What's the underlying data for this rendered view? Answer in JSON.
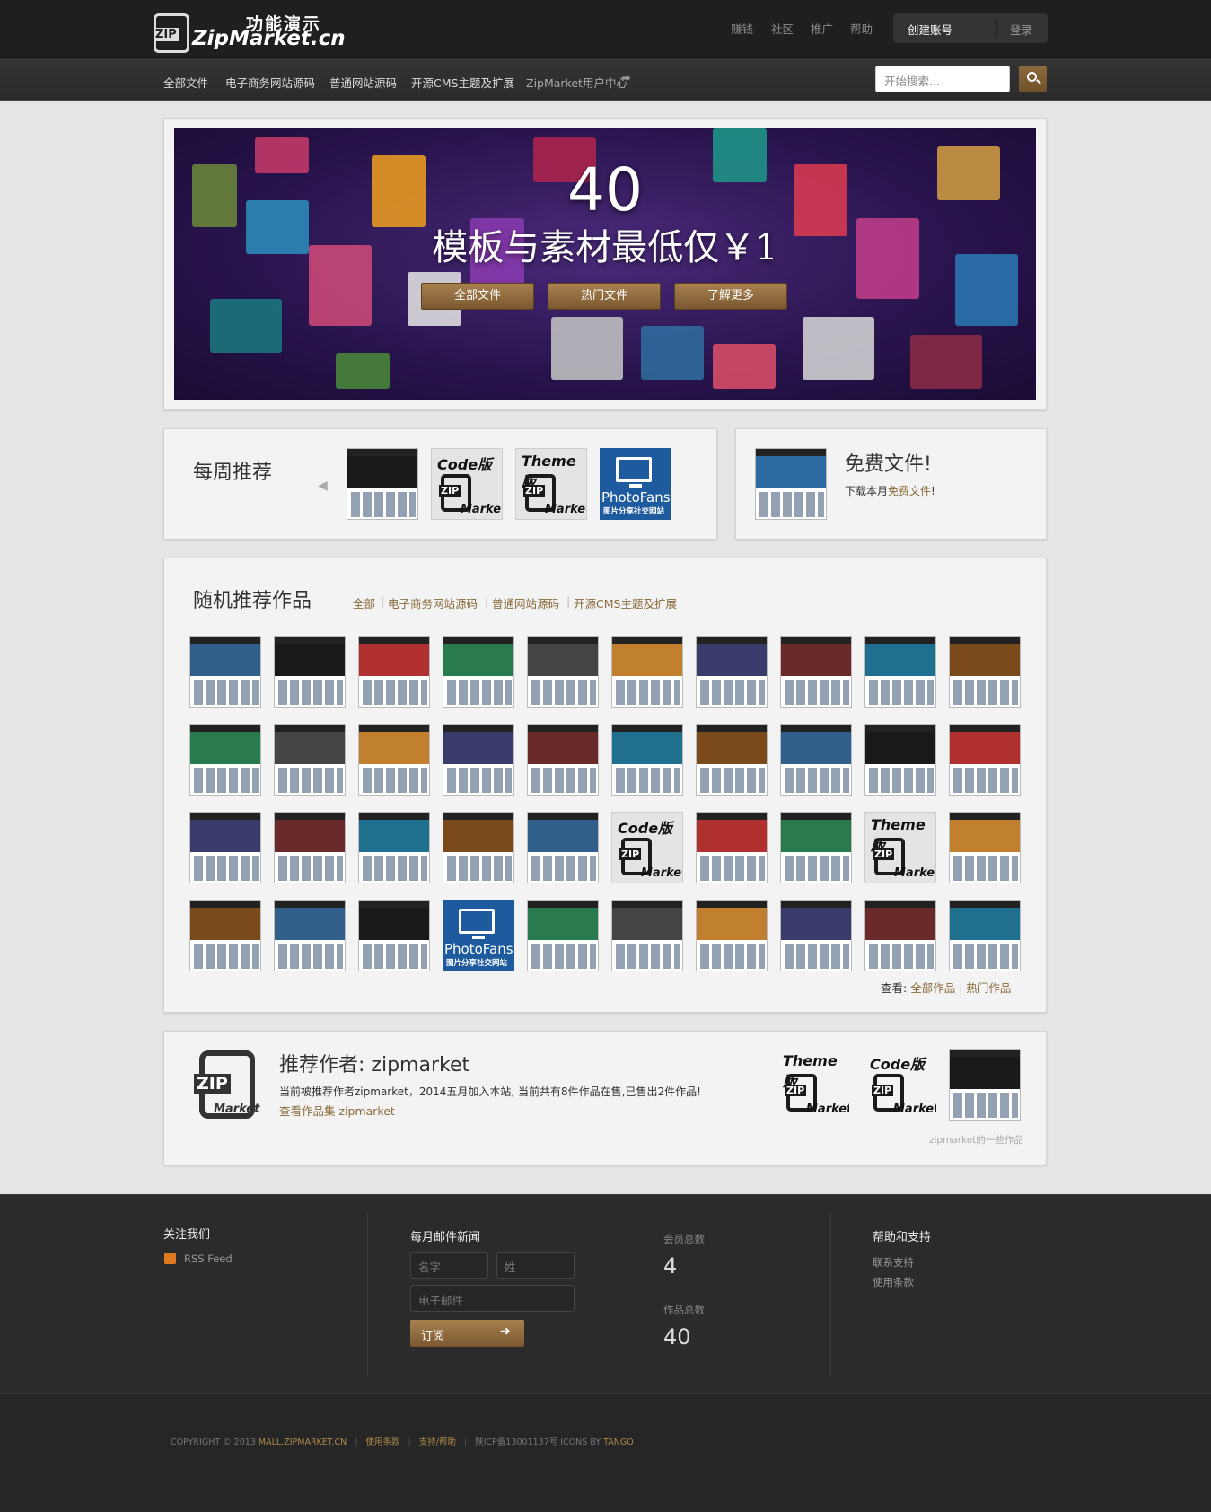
{
  "brand": {
    "logo_badge": "ZIP",
    "name_cn": "功能演示",
    "name_en": "ZipMarket.cn"
  },
  "top_nav": {
    "links": [
      "赚钱",
      "社区",
      "推广",
      "帮助"
    ],
    "create_account": "创建账号",
    "login": "登录"
  },
  "main_nav": {
    "links": [
      "全部文件",
      "电子商务网站源码",
      "普通网站源码",
      "开源CMS主题及扩展",
      "ZipMarket用户中心"
    ]
  },
  "search": {
    "placeholder": "开始搜索..."
  },
  "hero": {
    "count": "40",
    "tagline": "模板与素材最低仅￥1",
    "buttons": [
      "全部文件",
      "热门文件",
      "了解更多"
    ]
  },
  "weekly": {
    "title": "每周推荐"
  },
  "free": {
    "title": "免费文件!",
    "text_prefix": "下载本月",
    "link": "免费文件",
    "text_suffix": "!"
  },
  "thumb_labels": {
    "code": "Code版",
    "theme": "Theme版",
    "zip": "ZIP",
    "market": "Market",
    "photofans": "PhotoFans",
    "photofans_sub": "图片分享社交网站"
  },
  "random": {
    "title": "随机推荐作品",
    "categories": [
      "全部",
      "电子商务网站源码",
      "普通网站源码",
      "开源CMS主题及扩展"
    ],
    "view_label": "查看:",
    "view_all": "全部作品",
    "view_sep": "|",
    "view_hot": "热门作品"
  },
  "author": {
    "label": "推荐作者:",
    "name": "zipmarket",
    "description": "当前被推荐作者zipmarket，2014五月加入本站, 当前共有8件作品在售,已售出2件作品!",
    "link": "查看作品集 zipmarket",
    "caption": "zipmarket的一些作品"
  },
  "footer": {
    "follow": {
      "title": "关注我们",
      "rss": "RSS Feed"
    },
    "newsletter": {
      "title": "每月邮件新闻",
      "first_name": "名字",
      "last_name": "姓",
      "email": "电子邮件",
      "subscribe": "订阅"
    },
    "stats": {
      "members_label": "会员总数",
      "members": "4",
      "items_label": "作品总数",
      "items": "40"
    },
    "help": {
      "title": "帮助和支持",
      "links": [
        "联系支持",
        "使用条款"
      ]
    }
  },
  "copyright": {
    "prefix": "COPYRIGHT © 2013",
    "site": "MALL.ZIPMARKET.CN",
    "terms": "使用条款",
    "support": "支持/帮助",
    "icp": "陕ICP备13001137号 ICONS BY",
    "tango": "TANGO"
  },
  "colors": {
    "accent": "#8a6a3a",
    "button": "#7a5830",
    "dark": "#1f1f1f"
  }
}
